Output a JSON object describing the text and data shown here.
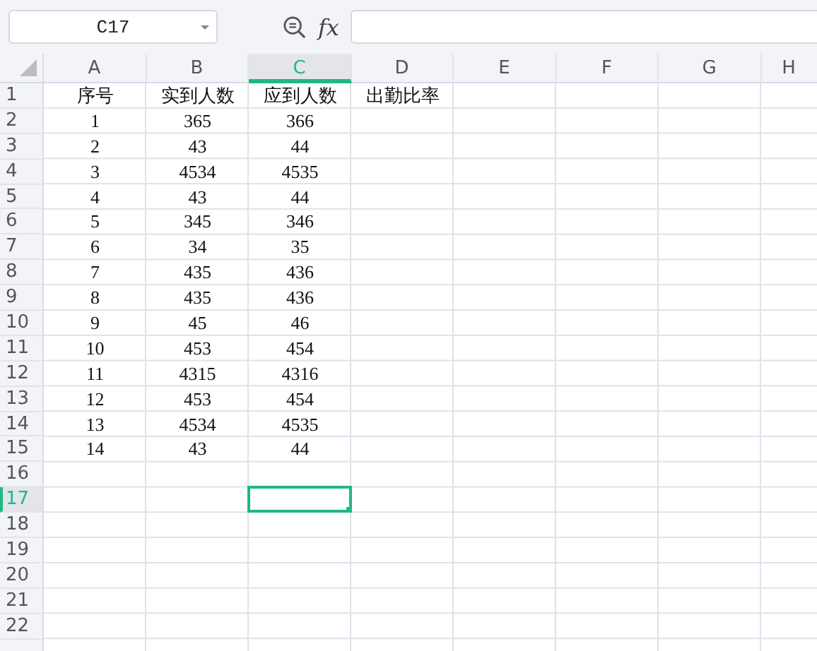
{
  "name_box": {
    "value": "C17"
  },
  "formula_bar": {
    "label": "fx"
  },
  "columns": [
    {
      "label": "A",
      "selected": false
    },
    {
      "label": "B",
      "selected": false
    },
    {
      "label": "C",
      "selected": true
    },
    {
      "label": "D",
      "selected": false
    },
    {
      "label": "E",
      "selected": false
    },
    {
      "label": "F",
      "selected": false
    },
    {
      "label": "G",
      "selected": false
    },
    {
      "label": "H",
      "selected": false
    }
  ],
  "rows": [
    {
      "label": "1",
      "selected": false,
      "cells": [
        "序号",
        "实到人数",
        "应到人数",
        "出勤比率"
      ]
    },
    {
      "label": "2",
      "selected": false,
      "cells": [
        "1",
        "365",
        "366"
      ]
    },
    {
      "label": "3",
      "selected": false,
      "cells": [
        "2",
        "43",
        "44"
      ]
    },
    {
      "label": "4",
      "selected": false,
      "cells": [
        "3",
        "4534",
        "4535"
      ]
    },
    {
      "label": "5",
      "selected": false,
      "cells": [
        "4",
        "43",
        "44"
      ]
    },
    {
      "label": "6",
      "selected": false,
      "cells": [
        "5",
        "345",
        "346"
      ]
    },
    {
      "label": "7",
      "selected": false,
      "cells": [
        "6",
        "34",
        "35"
      ]
    },
    {
      "label": "8",
      "selected": false,
      "cells": [
        "7",
        "435",
        "436"
      ]
    },
    {
      "label": "9",
      "selected": false,
      "cells": [
        "8",
        "435",
        "436"
      ]
    },
    {
      "label": "10",
      "selected": false,
      "cells": [
        "9",
        "45",
        "46"
      ]
    },
    {
      "label": "11",
      "selected": false,
      "cells": [
        "10",
        "453",
        "454"
      ]
    },
    {
      "label": "12",
      "selected": false,
      "cells": [
        "11",
        "4315",
        "4316"
      ]
    },
    {
      "label": "13",
      "selected": false,
      "cells": [
        "12",
        "453",
        "454"
      ]
    },
    {
      "label": "14",
      "selected": false,
      "cells": [
        "13",
        "4534",
        "4535"
      ]
    },
    {
      "label": "15",
      "selected": false,
      "cells": [
        "14",
        "43",
        "44"
      ]
    },
    {
      "label": "16",
      "selected": false
    },
    {
      "label": "17",
      "selected": true
    },
    {
      "label": "18",
      "selected": false
    },
    {
      "label": "19",
      "selected": false
    },
    {
      "label": "20",
      "selected": false
    },
    {
      "label": "21",
      "selected": false
    },
    {
      "label": "22",
      "selected": false
    }
  ]
}
